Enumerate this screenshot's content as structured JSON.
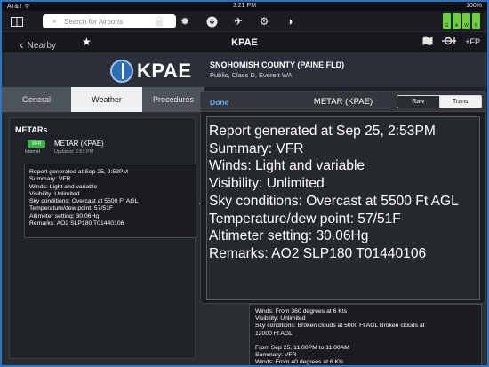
{
  "statusbar": {
    "carrier": "AT&T ᯤ",
    "time": "3:21 PM",
    "battery": "100%"
  },
  "toolbar": {
    "search_placeholder": "Search for Airports",
    "icons": [
      "split-view-icon",
      "lock-icon",
      "brightness-icon",
      "download-icon",
      "airplane-icon",
      "gear-icon",
      "contrast-icon"
    ]
  },
  "nav": {
    "back_label": "Nearby",
    "title": "KPAE",
    "fp_label": "+FP"
  },
  "airport": {
    "code": "KPAE",
    "name": "SNOHOMISH COUNTY (PAINE FLD)",
    "subtitle": "Public, Class D, Everett WA"
  },
  "tabs": [
    {
      "label": "General"
    },
    {
      "label": "Weather"
    },
    {
      "label": "Procedures"
    }
  ],
  "metars": {
    "title": "METARs",
    "badge": "VFR",
    "source": "Internet",
    "row_title": "METAR (KPAE)",
    "row_updated": "Updated: 2:53 PM",
    "lines": [
      "Report generated at Sep 25, 2:53PM",
      "Summary: VFR",
      "Winds: Light and variable",
      "Visibility: Unlimited",
      "Sky conditions: Overcast at 5500 Ft AGL",
      "Temperature/dew point: 57/51F",
      "Altimeter setting: 30.06Hg",
      "Remarks: AO2 SLP180 T01440106"
    ]
  },
  "taf": {
    "lines": [
      "Winds: From 360 degrees at 6 Kts",
      "Visibility: Unlimited",
      "Sky conditions: Broken clouds at 5000 Ft AGL Broken clouds at",
      "12000 Ft AGL",
      "",
      "From Sep 25, 11:00PM to 11:00AM",
      "Summary: VFR",
      "Winds: From 40 degrees at 6 Kts"
    ]
  },
  "popover": {
    "done_label": "Done",
    "title": "METAR (KPAE)",
    "seg_raw": "Raw",
    "seg_trans": "Trans",
    "lines": [
      "Report generated at Sep 25, 2:53PM",
      "Summary: VFR",
      "Winds: Light and variable",
      "Visibility: Unlimited",
      "Sky conditions: Overcast at 5500 Ft AGL",
      "Temperature/dew point: 57/51F",
      "Altimeter setting: 30.06Hg",
      "Remarks: AO2 SLP180 T01440106"
    ]
  },
  "colors": {
    "accent": "#5ab2ff",
    "vfr": "#37b445",
    "frame": "#2e74c8"
  }
}
